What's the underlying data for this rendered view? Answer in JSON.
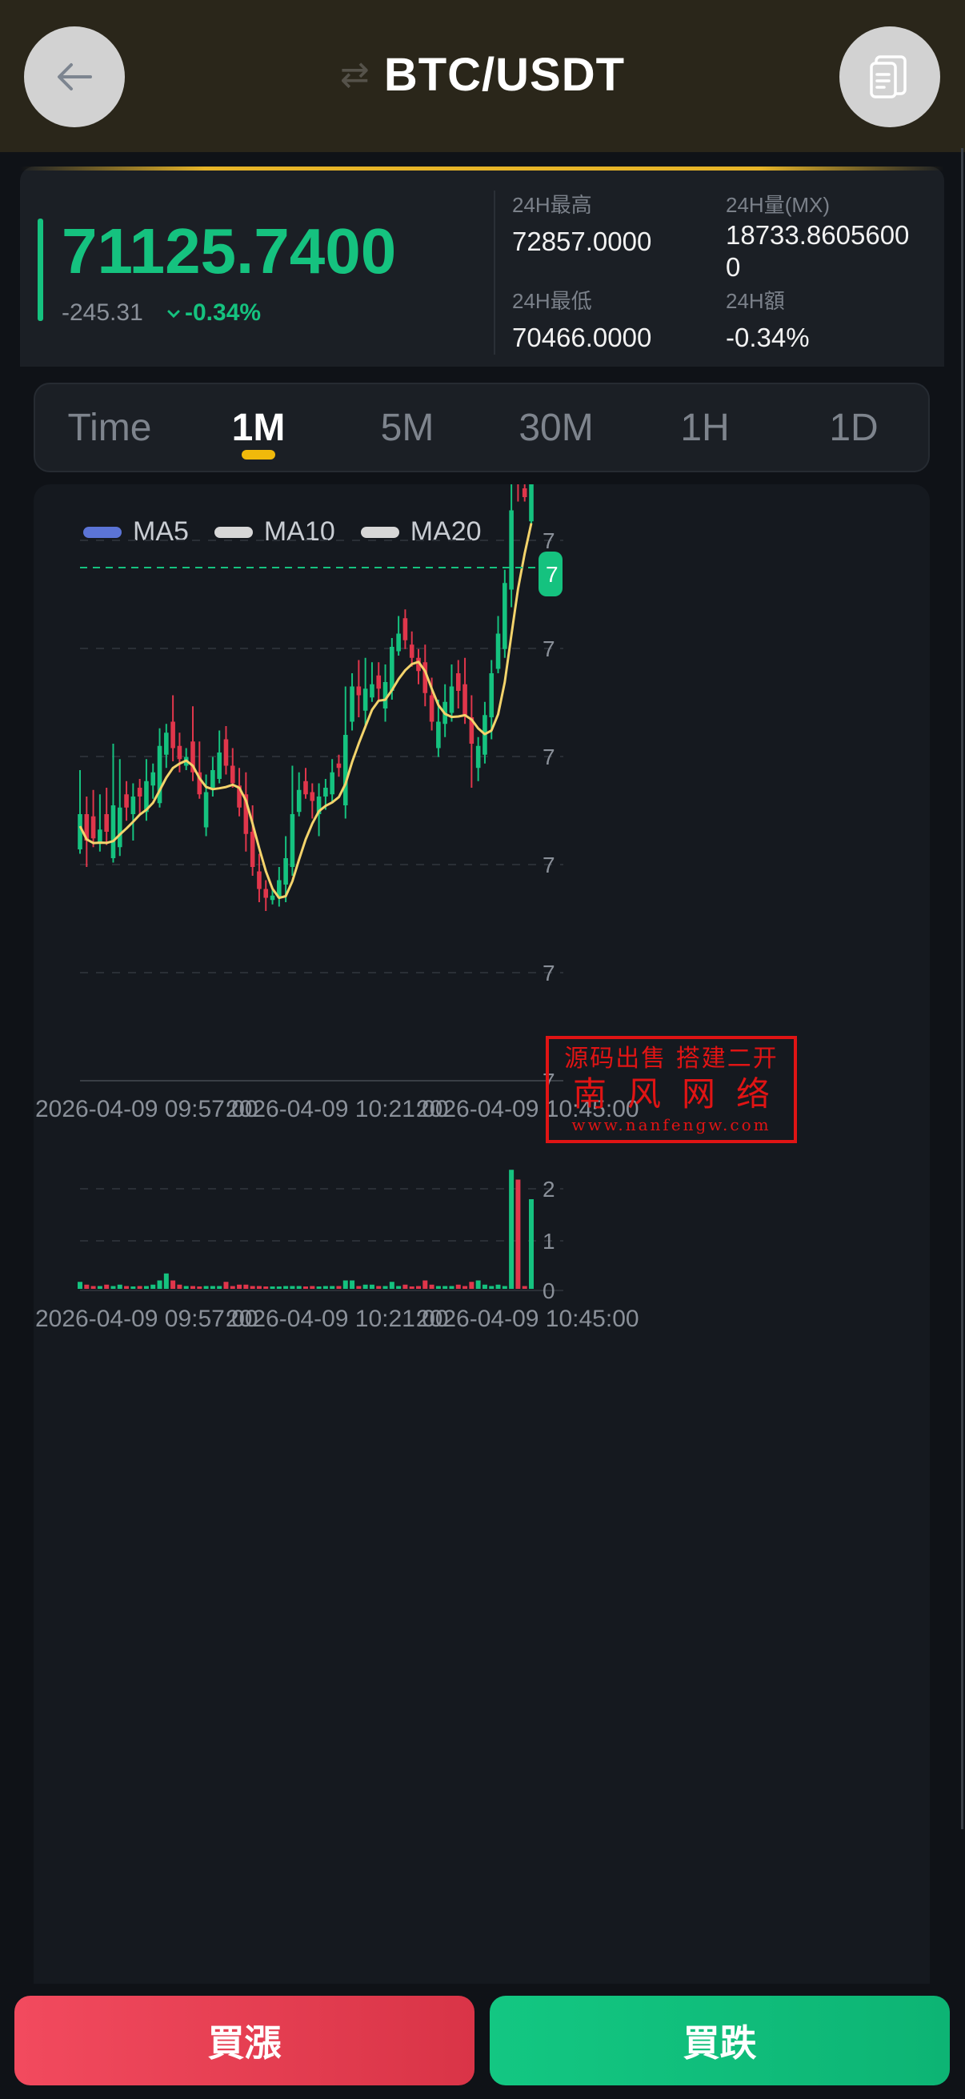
{
  "header": {
    "title": "BTC/USDT",
    "back_icon": "arrow-left-icon",
    "doc_icon": "document-icon"
  },
  "summary": {
    "last_price": "71125.7400",
    "change_abs": "-245.31",
    "change_pct": "-0.34%",
    "high_label": "24H最高",
    "high_value": "72857.0000",
    "low_label": "24H最低",
    "low_value": "70466.0000",
    "vol_label": "24H量(MX)",
    "vol_value_line1": "18733.8605600",
    "vol_value_line2": "0",
    "amt_label": "24H額",
    "amt_value": "-0.34%"
  },
  "tabs": [
    "Time",
    "1M",
    "5M",
    "30M",
    "1H",
    "1D"
  ],
  "active_tab": "1M",
  "legend": [
    {
      "name": "MA5",
      "color": "#5b74d6"
    },
    {
      "name": "MA10",
      "color": "#d7d7d7"
    },
    {
      "name": "MA20",
      "color": "#d7d7d7"
    }
  ],
  "axis": {
    "price_ticks": [
      "7",
      "7",
      "7",
      "7",
      "7",
      "7"
    ],
    "current_tag": "7",
    "volume_ticks": [
      "2",
      "1",
      "0"
    ],
    "time_labels": [
      "2026-04-09 09:57:00",
      "2026-04-09 10:21:00",
      "2026-04-09 10:45:00"
    ]
  },
  "watermark": {
    "line1": "源码出售 搭建二开",
    "line2": "南风网络",
    "line3": "www.nanfengw.com"
  },
  "buttons": {
    "buy_up": "買漲",
    "buy_down": "買跌"
  },
  "colors": {
    "up": "#15c27f",
    "down": "#e0364b",
    "accent": "#f0b90b",
    "ma_line": "#f3d36b"
  },
  "candles": [
    [
      0.8,
      0.2,
      1.0,
      0.1
    ],
    [
      -0.6,
      0.3,
      0.4,
      0.6
    ],
    [
      -0.5,
      0.3,
      0.6,
      0.2
    ],
    [
      0.3,
      0.1,
      0.8,
      0.2
    ],
    [
      -0.4,
      0.4,
      0.6,
      0.3
    ],
    [
      1.2,
      0.2,
      1.4,
      0.1
    ],
    [
      0.9,
      0.3,
      1.1,
      0.2
    ],
    [
      -0.3,
      0.9,
      0.3,
      0.3
    ],
    [
      0.4,
      0.8,
      0.3,
      0.6
    ],
    [
      -0.2,
      1.1,
      0.2,
      0.4
    ],
    [
      0.7,
      1.0,
      0.5,
      0.2
    ],
    [
      0.3,
      1.4,
      0.2,
      0.3
    ],
    [
      1.3,
      1.5,
      0.4,
      0.1
    ],
    [
      0.5,
      2.2,
      0.2,
      0.3
    ],
    [
      -0.6,
      2.4,
      0.6,
      0.3
    ],
    [
      -0.3,
      2.0,
      0.3,
      0.3
    ],
    [
      0.2,
      1.8,
      0.2,
      0.1
    ],
    [
      -0.7,
      1.9,
      0.8,
      0.2
    ],
    [
      -0.5,
      1.3,
      0.7,
      0.1
    ],
    [
      0.8,
      0.7,
      0.4,
      0.2
    ],
    [
      0.4,
      1.4,
      0.3,
      0.2
    ],
    [
      0.6,
      1.7,
      0.5,
      0.1
    ],
    [
      -0.6,
      2.0,
      0.3,
      0.2
    ],
    [
      -0.4,
      1.5,
      0.4,
      0.1
    ],
    [
      -0.5,
      1.0,
      0.4,
      0.2
    ],
    [
      -0.9,
      0.6,
      0.5,
      0.4
    ],
    [
      -0.8,
      -0.2,
      0.6,
      0.2
    ],
    [
      -0.4,
      -0.9,
      0.4,
      0.3
    ],
    [
      -0.2,
      -1.2,
      0.2,
      0.3
    ],
    [
      0.1,
      -1.3,
      0.2,
      0.1
    ],
    [
      0.4,
      -1.1,
      0.3,
      0.2
    ],
    [
      0.6,
      -0.7,
      0.5,
      0.4
    ],
    [
      1.2,
      0.0,
      1.1,
      0.2
    ],
    [
      0.5,
      0.9,
      0.4,
      0.1
    ],
    [
      -0.3,
      1.2,
      0.3,
      0.1
    ],
    [
      -0.2,
      1.0,
      0.2,
      0.4
    ],
    [
      0.4,
      0.8,
      0.3,
      0.5
    ],
    [
      0.2,
      1.1,
      0.2,
      0.3
    ],
    [
      0.5,
      1.3,
      0.3,
      0.2
    ],
    [
      -0.1,
      1.7,
      0.2,
      0.2
    ],
    [
      1.6,
      1.6,
      1.1,
      0.3
    ],
    [
      0.8,
      3.1,
      0.3,
      0.2
    ],
    [
      -0.2,
      3.4,
      0.6,
      0.5
    ],
    [
      0.5,
      3.2,
      0.7,
      0.4
    ],
    [
      0.3,
      3.4,
      0.5,
      0.1
    ],
    [
      -0.3,
      3.6,
      0.3,
      0.3
    ],
    [
      0.6,
      3.3,
      0.4,
      0.3
    ],
    [
      1.0,
      3.9,
      0.2,
      0.2
    ],
    [
      0.4,
      4.5,
      0.4,
      0.1
    ],
    [
      -0.5,
      4.8,
      0.2,
      0.2
    ],
    [
      -0.3,
      4.3,
      0.3,
      0.2
    ],
    [
      -0.3,
      4.0,
      0.2,
      0.3
    ],
    [
      -0.7,
      3.7,
      0.4,
      0.3
    ],
    [
      -0.6,
      3.0,
      0.4,
      0.2
    ],
    [
      0.6,
      2.4,
      0.5,
      0.2
    ],
    [
      0.5,
      2.9,
      0.4,
      0.3
    ],
    [
      0.6,
      3.2,
      0.5,
      0.2
    ],
    [
      -0.4,
      3.6,
      0.3,
      0.4
    ],
    [
      -0.7,
      3.2,
      0.6,
      0.2
    ],
    [
      -0.6,
      2.5,
      0.5,
      1.0
    ],
    [
      0.5,
      1.9,
      0.2,
      0.3
    ],
    [
      0.9,
      2.4,
      0.3,
      0.2
    ],
    [
      1.0,
      3.3,
      0.3,
      0.5
    ],
    [
      0.8,
      4.3,
      0.4,
      0.1
    ],
    [
      1.5,
      5.1,
      0.3,
      0.2
    ],
    [
      1.8,
      6.6,
      0.8,
      0.4
    ],
    [
      -0.2,
      8.2,
      0.6,
      0.4
    ],
    [
      -0.2,
      7.9,
      0.4,
      0.1
    ],
    [
      0.9,
      7.7,
      0.4,
      0.1
    ]
  ],
  "volumes": [
    0.05,
    0.03,
    0.02,
    0.02,
    0.03,
    0.02,
    0.03,
    0.02,
    0.01,
    0.02,
    0.02,
    0.03,
    0.06,
    0.11,
    0.06,
    0.03,
    0.02,
    0.02,
    0.01,
    0.02,
    0.02,
    0.02,
    0.05,
    0.02,
    0.03,
    0.03,
    0.02,
    0.02,
    0.01,
    0.01,
    0.01,
    0.02,
    0.02,
    0.02,
    0.01,
    0.02,
    0.01,
    0.02,
    0.02,
    0.02,
    0.06,
    0.06,
    0.02,
    0.03,
    0.03,
    0.02,
    0.02,
    0.05,
    0.02,
    0.03,
    0.01,
    0.02,
    0.06,
    0.03,
    0.02,
    0.02,
    0.02,
    0.03,
    0.02,
    0.05,
    0.06,
    0.03,
    0.02,
    0.03,
    0.02,
    0.85,
    0.78,
    0.02,
    0.64,
    0.02,
    0.02
  ]
}
